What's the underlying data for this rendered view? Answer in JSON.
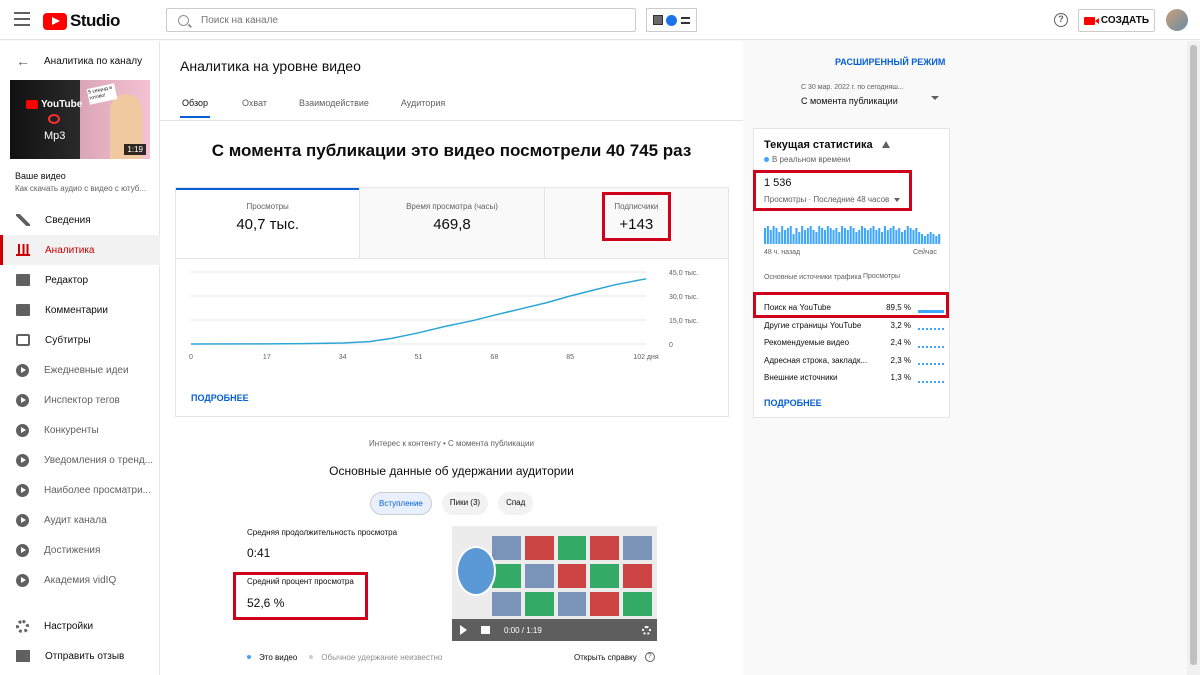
{
  "topbar": {
    "logo_text": "Studio",
    "search_placeholder": "Поиск на канале",
    "create_label": "СОЗДАТЬ"
  },
  "sidebar": {
    "back_label": "Аналитика по каналу",
    "thumb_yt_text": "YouTube",
    "thumb_mp3": "Mp3",
    "thumb_sticker": "5 секунд и готово!",
    "thumb_duration": "1:19",
    "your_video": "Ваше видео",
    "video_title": "Как скачать аудио с видео с ютуб...",
    "items": [
      {
        "label": "Сведения",
        "icon": "pencil-icon"
      },
      {
        "label": "Аналитика",
        "icon": "analytics-icon"
      },
      {
        "label": "Редактор",
        "icon": "film-icon"
      },
      {
        "label": "Комментарии",
        "icon": "comment-icon"
      },
      {
        "label": "Субтитры",
        "icon": "subtitles-icon"
      },
      {
        "label": "Ежедневные идеи",
        "icon": "vidiq-icon"
      },
      {
        "label": "Инспектор тегов",
        "icon": "vidiq-icon"
      },
      {
        "label": "Конкуренты",
        "icon": "vidiq-icon"
      },
      {
        "label": "Уведомления о тренд...",
        "icon": "vidiq-icon"
      },
      {
        "label": "Наиболее просматри...",
        "icon": "vidiq-icon"
      },
      {
        "label": "Аудит канала",
        "icon": "vidiq-icon"
      },
      {
        "label": "Достижения",
        "icon": "vidiq-icon"
      },
      {
        "label": "Академия vidIQ",
        "icon": "vidiq-icon"
      }
    ],
    "bottom": [
      {
        "label": "Настройки",
        "icon": "gear-icon"
      },
      {
        "label": "Отправить отзыв",
        "icon": "feedback-icon"
      }
    ]
  },
  "main": {
    "title": "Аналитика на уровне видео",
    "tabs": [
      {
        "label": "Обзор"
      },
      {
        "label": "Охват"
      },
      {
        "label": "Взаимодействие"
      },
      {
        "label": "Аудитория"
      }
    ],
    "headline": "С момента публикации это видео посмотрели 40 745 раз",
    "metrics": [
      {
        "label": "Просмотры",
        "value": "40,7 тыс."
      },
      {
        "label": "Время просмотра (часы)",
        "value": "469,8"
      },
      {
        "label": "Подписчики",
        "value": "+143"
      }
    ],
    "more_label": "ПОДРОБНЕЕ",
    "retention_head": "Интерес к контенту • С момента публикации",
    "retention_title": "Основные данные об удержании аудитории",
    "chips": [
      {
        "label": "Вступление"
      },
      {
        "label": "Пики (3)"
      },
      {
        "label": "Спад"
      }
    ],
    "avg_duration_label": "Средняя продолжительность просмотра",
    "avg_duration_value": "0:41",
    "avg_percent_label": "Средний процент просмотра",
    "avg_percent_value": "52,6 %",
    "player_time": "0:00 / 1:19",
    "legend": [
      {
        "label": "Это видео",
        "color": "#3ea6ff"
      },
      {
        "label": "Обычное удержание неизвестно",
        "color": "#cccccc"
      }
    ],
    "help_link": "Открыть справку"
  },
  "chart_data": {
    "type": "line",
    "x_ticks": [
      "0",
      "17",
      "34",
      "51",
      "68",
      "85",
      "102 дня"
    ],
    "y_ticks": [
      "0",
      "15,0 тыс.",
      "30,0 тыс.",
      "45,0 тыс."
    ],
    "ylim": [
      0,
      45000
    ],
    "xlim": [
      0,
      102
    ],
    "series": [
      {
        "color": "#2ca6d5",
        "x": [
          0,
          17,
          25,
          34,
          40,
          45,
          51,
          57,
          63,
          68,
          74,
          80,
          85,
          90,
          95,
          102
        ],
        "y": [
          0,
          50,
          200,
          600,
          1500,
          3500,
          7000,
          11000,
          14500,
          18000,
          22000,
          26000,
          30000,
          33500,
          37000,
          40745
        ]
      }
    ]
  },
  "right": {
    "advanced_mode": "РАСШИРЕННЫЙ РЕЖИМ",
    "date_sub": "С 30 мар. 2022 г. по сегодняш...",
    "date_main": "С момента публикации",
    "rt_title": "Текущая статистика",
    "rt_live": "В реальном времени",
    "rt_count": "1 536",
    "rt_period": "Просмотры · Последние 48 часов",
    "spark_left": "48 ч. назад",
    "spark_right": "Сейчас",
    "spark_values": [
      8,
      9,
      7,
      9,
      8,
      6,
      9,
      7,
      8,
      9,
      5,
      8,
      6,
      9,
      7,
      8,
      9,
      7,
      6,
      9,
      8,
      7,
      9,
      8,
      7,
      8,
      6,
      9,
      8,
      7,
      9,
      8,
      6,
      7,
      9,
      8,
      7,
      8,
      9,
      7,
      8,
      6,
      9,
      7,
      8,
      9,
      7,
      8,
      6,
      7,
      9,
      8,
      7,
      8,
      6,
      5,
      4,
      5,
      6,
      5,
      4,
      5
    ],
    "src_head": "Основные источники трафика",
    "src_head_views": "Просмотры",
    "sources": [
      {
        "name": "Поиск на YouTube",
        "value": "89,5 %",
        "strong": true
      },
      {
        "name": "Другие страницы YouTube",
        "value": "3,2 %",
        "strong": false
      },
      {
        "name": "Рекомендуемые видео",
        "value": "2,4 %",
        "strong": false
      },
      {
        "name": "Адресная строка, закладк...",
        "value": "2,3 %",
        "strong": false
      },
      {
        "name": "Внешние источники",
        "value": "1,3 %",
        "strong": false
      }
    ],
    "more_label": "ПОДРОБНЕЕ"
  }
}
